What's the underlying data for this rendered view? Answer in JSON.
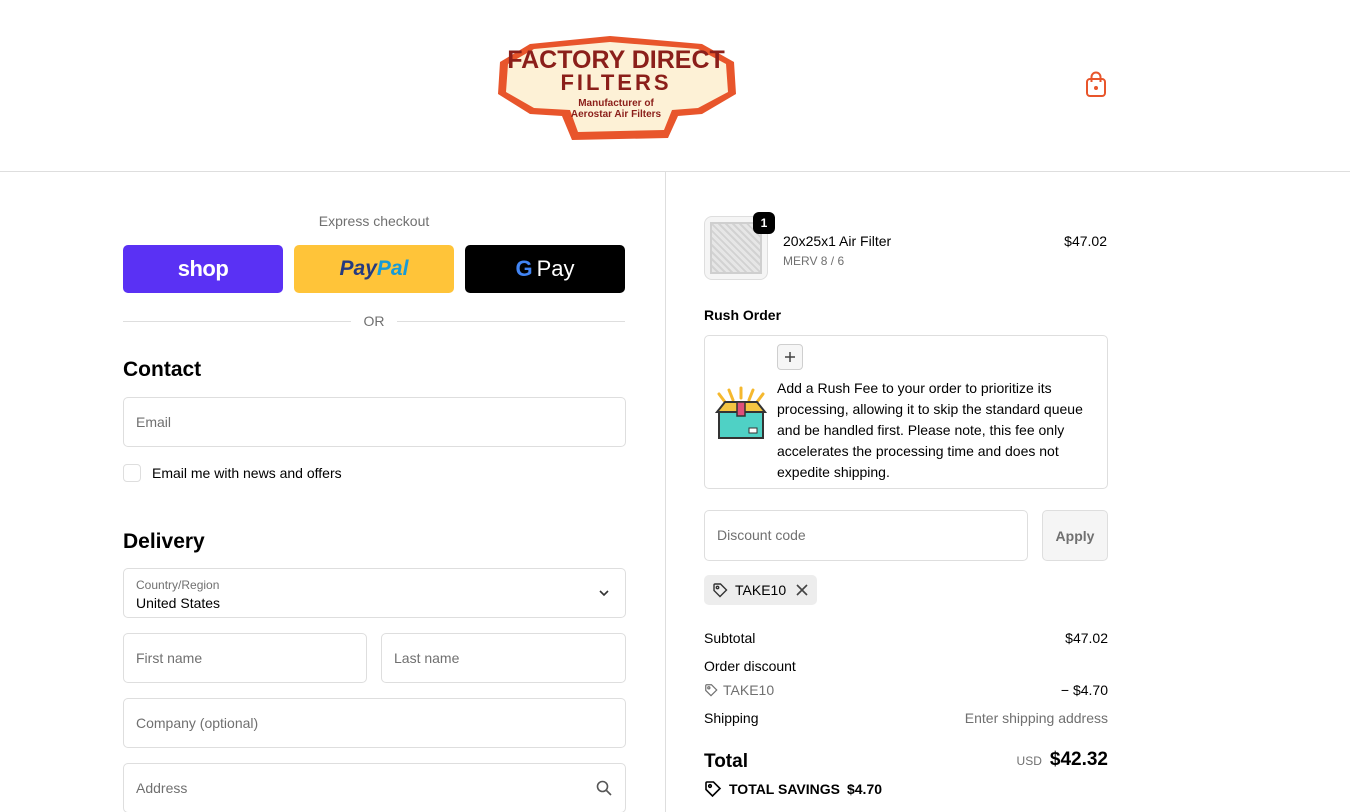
{
  "header": {
    "logo": {
      "line1": "FACTORY DIRECT",
      "line2": "FILTERS",
      "tagline1": "Manufacturer of",
      "tagline2": "Aerostar Air Filters"
    },
    "cart_icon": "shopping-bag-icon"
  },
  "express": {
    "label": "Express checkout",
    "shop_label": "shop",
    "paypal_label_1": "Pay",
    "paypal_label_2": "Pal",
    "gpay_g": "G",
    "gpay_label": "Pay",
    "or_label": "OR"
  },
  "contact": {
    "title": "Contact",
    "email_placeholder": "Email",
    "newsletter_label": "Email me with news and offers"
  },
  "delivery": {
    "title": "Delivery",
    "country_label": "Country/Region",
    "country_value": "United States",
    "first_name_placeholder": "First name",
    "last_name_placeholder": "Last name",
    "company_placeholder": "Company (optional)",
    "address_placeholder": "Address"
  },
  "order": {
    "quantity": "1",
    "product_name": "20x25x1 Air Filter",
    "product_variant": "MERV 8 / 6",
    "product_price": "$47.02"
  },
  "rush": {
    "title": "Rush Order",
    "description": "Add a Rush Fee to your order to prioritize its processing, allowing it to skip the standard queue and be handled first. Please note, this fee only accelerates the processing time and does not expedite shipping."
  },
  "discount": {
    "placeholder": "Discount code",
    "apply_label": "Apply",
    "applied_code": "TAKE10"
  },
  "summary": {
    "subtotal_label": "Subtotal",
    "subtotal_value": "$47.02",
    "order_discount_label": "Order discount",
    "discount_code": "TAKE10",
    "discount_value": "− $4.70",
    "shipping_label": "Shipping",
    "shipping_value": "Enter shipping address",
    "total_label": "Total",
    "currency": "USD",
    "total_value": "$42.32",
    "savings_label": "TOTAL SAVINGS",
    "savings_value": "$4.70"
  },
  "colors": {
    "shop_purple": "#5a31f4",
    "paypal_yellow": "#ffc439",
    "gpay_black": "#000000",
    "logo_orange": "#e8552b",
    "logo_cream": "#fdf1d6",
    "logo_maroon": "#8b1f1a"
  }
}
